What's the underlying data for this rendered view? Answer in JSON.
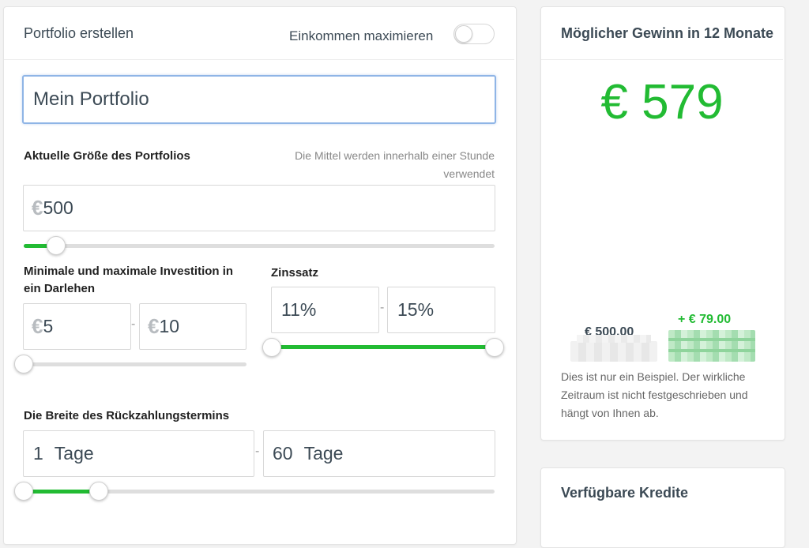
{
  "portfolio": {
    "title": "Portfolio erstellen",
    "maximize_income_label": "Einkommen maximieren",
    "maximize_income_on": false,
    "name_value": "Mein Portfolio",
    "size": {
      "label": "Aktuelle Größe des Portfolios",
      "hint": "Die Mittel werden innerhalb einer Stunde verwendet",
      "currency": "€",
      "value": "500",
      "slider_fraction": 0.05
    },
    "investment": {
      "label": "Minimale und maximale Investition in ein Darlehen",
      "currency": "€",
      "min": "5",
      "max": "10",
      "dash": "-",
      "slider_fraction": 0.0
    },
    "interest": {
      "label": "Zinssatz",
      "min": "11%",
      "max": "15%",
      "dash": "-",
      "slider_min_fraction": 0.0,
      "slider_max_fraction": 1.0
    },
    "term": {
      "label": "Die Breite des Rückzahlungstermins",
      "min_days": "1",
      "max_days": "60",
      "unit": "Tage",
      "dash": "-",
      "slider_min_fraction": 0.0,
      "slider_max_fraction": 0.16
    }
  },
  "gain": {
    "title": "Möglicher Gewinn in 12 Monate",
    "value": "€ 579",
    "base_amount": "€ 500.00",
    "profit_amount": "+ € 79.00",
    "note": "Dies ist nur ein Beispiel. Der wirkliche Zeitraum ist nicht festgeschrieben und hängt von Ihnen ab."
  },
  "credits": {
    "title": "Verfügbare Kredite"
  },
  "colors": {
    "accent_green": "#22bb33",
    "focus_blue": "#8fb5e6",
    "text_dark": "#3c4a55"
  }
}
